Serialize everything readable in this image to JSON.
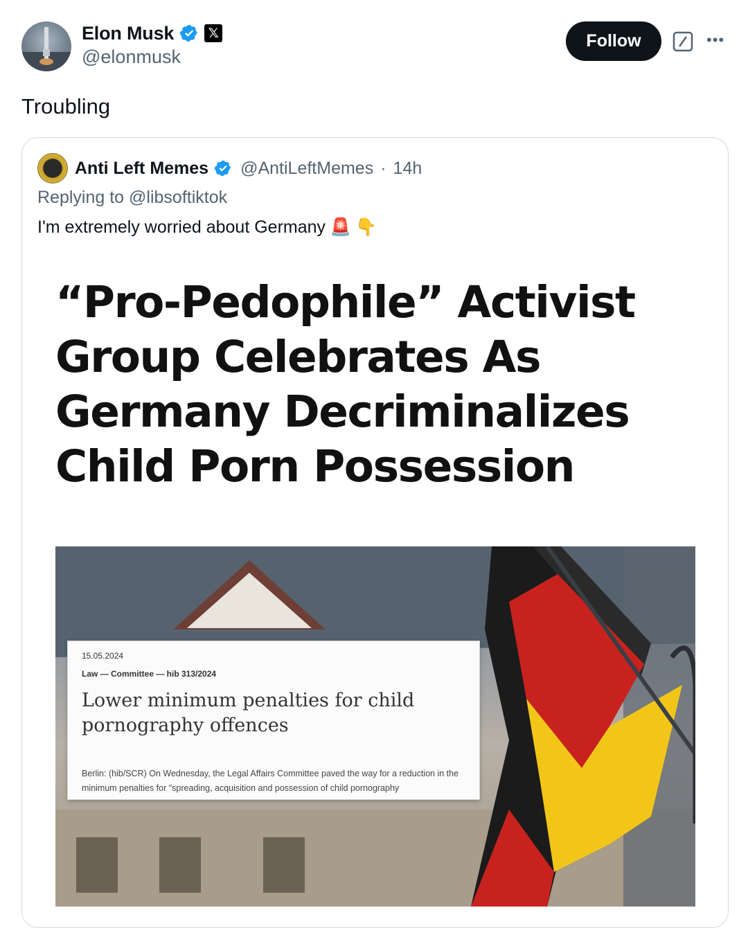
{
  "tweet": {
    "author": {
      "display_name": "Elon Musk",
      "handle": "@elonmusk",
      "verified_icon": "verified-badge-icon",
      "affiliation_icon": "x-logo-icon"
    },
    "follow_label": "Follow",
    "text": "Troubling"
  },
  "quoted": {
    "display_name": "Anti Left Memes",
    "handle": "@AntiLeftMemes",
    "separator": "·",
    "time": "14h",
    "replying_prefix": "Replying to",
    "replying_to": "@libsoftiktok",
    "text": "I'm extremely worried about Germany",
    "emojis": [
      "🚨",
      "👇"
    ],
    "media": {
      "headline": "“Pro-Pedophile” Activist Group Celebrates As Germany Decriminalizes Child Porn Possession",
      "doc": {
        "date": "15.05.2024",
        "category": "Law — Committee — hib 313/2024",
        "title": "Lower minimum penalties for child pornography offences",
        "body": "Berlin: (hib/SCR) On Wednesday, the Legal Affairs Committee paved the way for a reduction in the minimum penalties for \"spreading, acquisition and possession of child pornography"
      }
    }
  },
  "colors": {
    "verified": "#1d9bf0",
    "follow_bg": "#0f1419",
    "secondary_text": "#536471",
    "border": "#cfd9de"
  }
}
